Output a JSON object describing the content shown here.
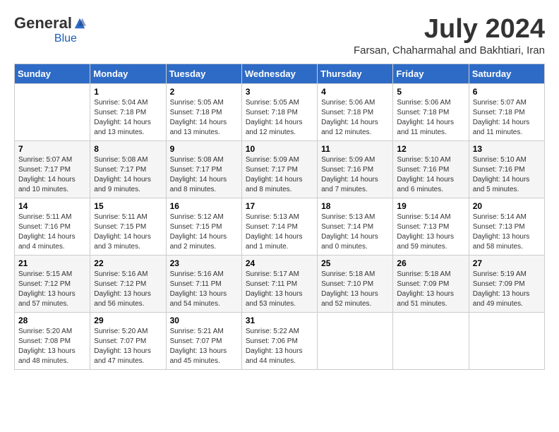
{
  "logo": {
    "general": "General",
    "blue": "Blue"
  },
  "title": "July 2024",
  "subtitle": "Farsan, Chaharmahal and Bakhtiari, Iran",
  "headers": [
    "Sunday",
    "Monday",
    "Tuesday",
    "Wednesday",
    "Thursday",
    "Friday",
    "Saturday"
  ],
  "weeks": [
    [
      {
        "day": "",
        "info": ""
      },
      {
        "day": "1",
        "info": "Sunrise: 5:04 AM\nSunset: 7:18 PM\nDaylight: 14 hours\nand 13 minutes."
      },
      {
        "day": "2",
        "info": "Sunrise: 5:05 AM\nSunset: 7:18 PM\nDaylight: 14 hours\nand 13 minutes."
      },
      {
        "day": "3",
        "info": "Sunrise: 5:05 AM\nSunset: 7:18 PM\nDaylight: 14 hours\nand 12 minutes."
      },
      {
        "day": "4",
        "info": "Sunrise: 5:06 AM\nSunset: 7:18 PM\nDaylight: 14 hours\nand 12 minutes."
      },
      {
        "day": "5",
        "info": "Sunrise: 5:06 AM\nSunset: 7:18 PM\nDaylight: 14 hours\nand 11 minutes."
      },
      {
        "day": "6",
        "info": "Sunrise: 5:07 AM\nSunset: 7:18 PM\nDaylight: 14 hours\nand 11 minutes."
      }
    ],
    [
      {
        "day": "7",
        "info": "Sunrise: 5:07 AM\nSunset: 7:17 PM\nDaylight: 14 hours\nand 10 minutes."
      },
      {
        "day": "8",
        "info": "Sunrise: 5:08 AM\nSunset: 7:17 PM\nDaylight: 14 hours\nand 9 minutes."
      },
      {
        "day": "9",
        "info": "Sunrise: 5:08 AM\nSunset: 7:17 PM\nDaylight: 14 hours\nand 8 minutes."
      },
      {
        "day": "10",
        "info": "Sunrise: 5:09 AM\nSunset: 7:17 PM\nDaylight: 14 hours\nand 8 minutes."
      },
      {
        "day": "11",
        "info": "Sunrise: 5:09 AM\nSunset: 7:16 PM\nDaylight: 14 hours\nand 7 minutes."
      },
      {
        "day": "12",
        "info": "Sunrise: 5:10 AM\nSunset: 7:16 PM\nDaylight: 14 hours\nand 6 minutes."
      },
      {
        "day": "13",
        "info": "Sunrise: 5:10 AM\nSunset: 7:16 PM\nDaylight: 14 hours\nand 5 minutes."
      }
    ],
    [
      {
        "day": "14",
        "info": "Sunrise: 5:11 AM\nSunset: 7:16 PM\nDaylight: 14 hours\nand 4 minutes."
      },
      {
        "day": "15",
        "info": "Sunrise: 5:11 AM\nSunset: 7:15 PM\nDaylight: 14 hours\nand 3 minutes."
      },
      {
        "day": "16",
        "info": "Sunrise: 5:12 AM\nSunset: 7:15 PM\nDaylight: 14 hours\nand 2 minutes."
      },
      {
        "day": "17",
        "info": "Sunrise: 5:13 AM\nSunset: 7:14 PM\nDaylight: 14 hours\nand 1 minute."
      },
      {
        "day": "18",
        "info": "Sunrise: 5:13 AM\nSunset: 7:14 PM\nDaylight: 14 hours\nand 0 minutes."
      },
      {
        "day": "19",
        "info": "Sunrise: 5:14 AM\nSunset: 7:13 PM\nDaylight: 13 hours\nand 59 minutes."
      },
      {
        "day": "20",
        "info": "Sunrise: 5:14 AM\nSunset: 7:13 PM\nDaylight: 13 hours\nand 58 minutes."
      }
    ],
    [
      {
        "day": "21",
        "info": "Sunrise: 5:15 AM\nSunset: 7:12 PM\nDaylight: 13 hours\nand 57 minutes."
      },
      {
        "day": "22",
        "info": "Sunrise: 5:16 AM\nSunset: 7:12 PM\nDaylight: 13 hours\nand 56 minutes."
      },
      {
        "day": "23",
        "info": "Sunrise: 5:16 AM\nSunset: 7:11 PM\nDaylight: 13 hours\nand 54 minutes."
      },
      {
        "day": "24",
        "info": "Sunrise: 5:17 AM\nSunset: 7:11 PM\nDaylight: 13 hours\nand 53 minutes."
      },
      {
        "day": "25",
        "info": "Sunrise: 5:18 AM\nSunset: 7:10 PM\nDaylight: 13 hours\nand 52 minutes."
      },
      {
        "day": "26",
        "info": "Sunrise: 5:18 AM\nSunset: 7:09 PM\nDaylight: 13 hours\nand 51 minutes."
      },
      {
        "day": "27",
        "info": "Sunrise: 5:19 AM\nSunset: 7:09 PM\nDaylight: 13 hours\nand 49 minutes."
      }
    ],
    [
      {
        "day": "28",
        "info": "Sunrise: 5:20 AM\nSunset: 7:08 PM\nDaylight: 13 hours\nand 48 minutes."
      },
      {
        "day": "29",
        "info": "Sunrise: 5:20 AM\nSunset: 7:07 PM\nDaylight: 13 hours\nand 47 minutes."
      },
      {
        "day": "30",
        "info": "Sunrise: 5:21 AM\nSunset: 7:07 PM\nDaylight: 13 hours\nand 45 minutes."
      },
      {
        "day": "31",
        "info": "Sunrise: 5:22 AM\nSunset: 7:06 PM\nDaylight: 13 hours\nand 44 minutes."
      },
      {
        "day": "",
        "info": ""
      },
      {
        "day": "",
        "info": ""
      },
      {
        "day": "",
        "info": ""
      }
    ]
  ]
}
